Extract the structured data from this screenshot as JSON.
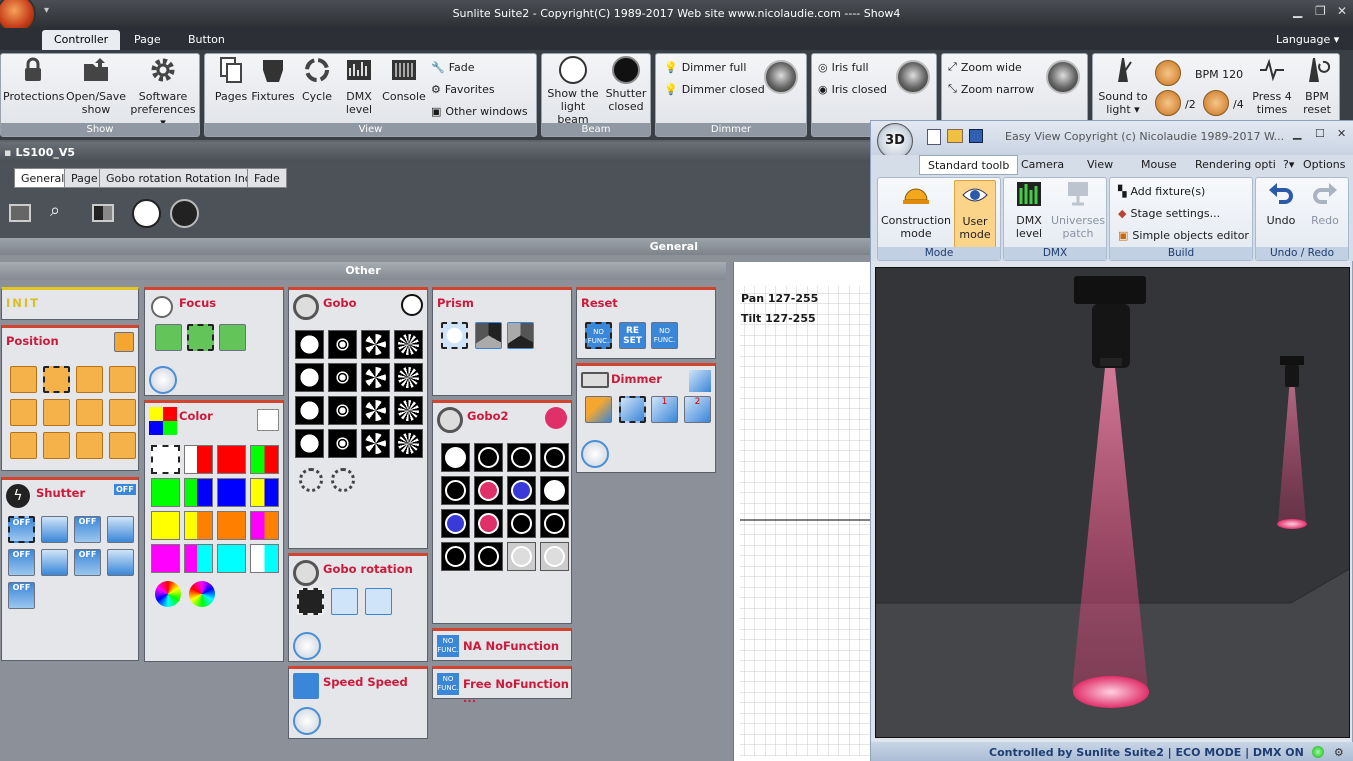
{
  "app": {
    "title": "Sunlite Suite2 - Copyright(C) 1989-2017    Web site www.nicolaudie.com ---- Show4",
    "language": "Language"
  },
  "ribbon_tabs": [
    "Controller",
    "Page",
    "Button"
  ],
  "ribbon": {
    "show": {
      "label": "Show",
      "protections": "Protections",
      "open_save_1": "Open/Save",
      "open_save_2": "show",
      "software_1": "Software",
      "software_2": "preferences"
    },
    "view": {
      "label": "View",
      "pages": "Pages",
      "fixtures": "Fixtures",
      "cycle": "Cycle",
      "dmx_1": "DMX",
      "dmx_2": "level",
      "console": "Console",
      "fade": "Fade",
      "favorites": "Favorites",
      "other_windows": "Other windows"
    },
    "beam": {
      "label": "Beam",
      "show_light_1": "Show the",
      "show_light_2": "light beam",
      "shutter_1": "Shutter",
      "shutter_2": "closed"
    },
    "dimmer": {
      "label": "Dimmer",
      "full": "Dimmer full",
      "closed": "Dimmer closed"
    },
    "iris": {
      "full": "Iris full",
      "closed": "Iris closed"
    },
    "zoom": {
      "wide": "Zoom wide",
      "narrow": "Zoom narrow"
    },
    "bpm": {
      "sound_1": "Sound to",
      "sound_2": "light",
      "bpm_value": "BPM 120",
      "div2": "/2",
      "div4": "/4",
      "press_1": "Press 4",
      "press_2": "times",
      "reset_1": "BPM",
      "reset_2": "reset"
    }
  },
  "fixture": {
    "name": "LS100_V5",
    "tabs": [
      "General",
      "Page",
      "Gobo rotation Rotation Index",
      "Fade"
    ],
    "general_header": "General",
    "other_header": "Other"
  },
  "boxes": {
    "init": "INIT",
    "position": "Position",
    "shutter": "Shutter",
    "focus": "Focus",
    "color": "Color",
    "gobo": "Gobo",
    "gobo_rotation": "Gobo rotation",
    "speed": "Speed Speed",
    "prism": "Prism",
    "gobo2": "Gobo2",
    "na": "NA NoFunction",
    "free": "Free NoFunction ...",
    "reset": "Reset",
    "dimmer": "Dimmer"
  },
  "badges": {
    "off": "OFF",
    "no_func_1": "NO",
    "no_func_2": "FUNC.",
    "re": "RE",
    "set": "SET",
    "one": "1",
    "two": "2"
  },
  "colors": [
    "#ffffff",
    "#ff0000",
    "#00ff00",
    "#0000ff",
    "#ffff00",
    "#ff8000",
    "#ff00ff",
    "#00ffff"
  ],
  "grid": {
    "pan": "Pan 127-255",
    "tilt": "Tilt 127-255"
  },
  "view3d": {
    "title": "Easy View   Copyright (c) Nicolaudie 1989-2017     W...",
    "badge": "3D",
    "tabs": [
      "Standard toolb",
      "Camera",
      "View",
      "Mouse",
      "Rendering opti",
      "?",
      "Options"
    ],
    "mode": {
      "label": "Mode",
      "construction_1": "Construction",
      "construction_2": "mode",
      "user_1": "User",
      "user_2": "mode"
    },
    "dmx": {
      "label": "DMX",
      "level_1": "DMX",
      "level_2": "level",
      "patch_1": "Universes",
      "patch_2": "patch"
    },
    "build": {
      "label": "Build",
      "add": "Add fixture(s)",
      "stage": "Stage settings...",
      "editor": "Simple objects editor"
    },
    "undo": {
      "label": "Undo / Redo",
      "undo": "Undo",
      "redo": "Redo"
    },
    "status": "Controlled by Sunlite Suite2  |  ECO MODE  |  DMX ON"
  }
}
